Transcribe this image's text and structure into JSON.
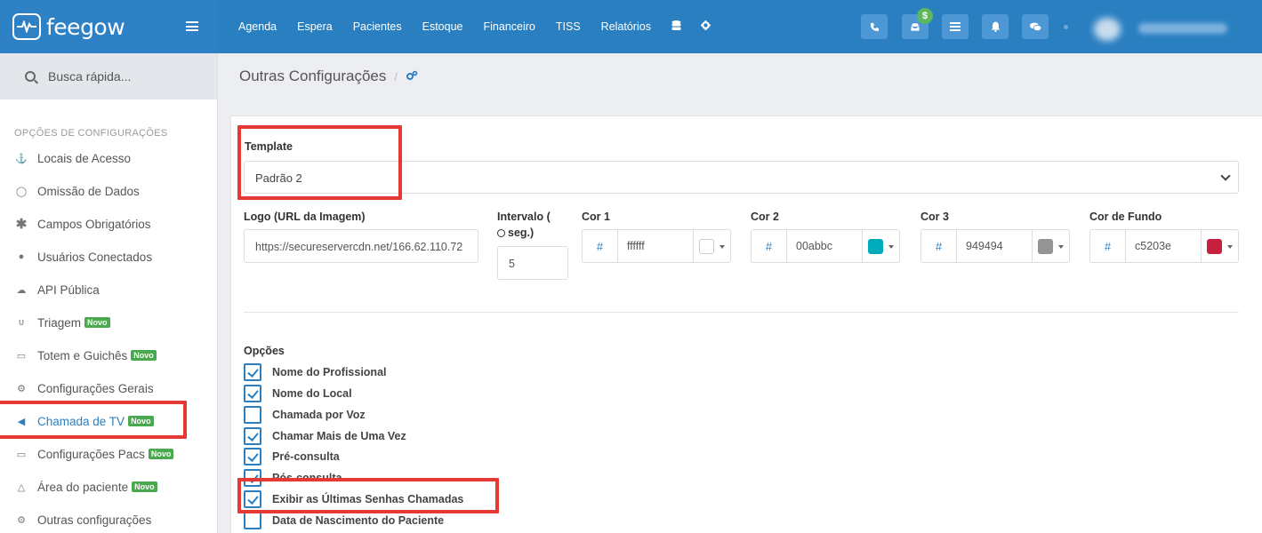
{
  "brand": {
    "name": "feegow"
  },
  "nav": [
    "Agenda",
    "Espera",
    "Pacientes",
    "Estoque",
    "Financeiro",
    "TISS",
    "Relatórios"
  ],
  "notification_badge": "$",
  "search": {
    "label": "Busca rápida..."
  },
  "sidebar": {
    "heading": "OPÇÕES DE CONFIGURAÇÕES",
    "items": [
      {
        "label": "Locais de Acesso",
        "icon": "map-pin-icon"
      },
      {
        "label": "Omissão de Dados",
        "icon": "eye-slash-icon"
      },
      {
        "label": "Campos Obrigatórios",
        "icon": "asterisk-icon"
      },
      {
        "label": "Usuários Conectados",
        "icon": "user-icon"
      },
      {
        "label": "API Pública",
        "icon": "cloud-icon"
      },
      {
        "label": "Triagem",
        "icon": "stethoscope-icon",
        "badge": "Novo"
      },
      {
        "label": "Totem e Guichês",
        "icon": "laptop-icon",
        "badge": "Novo"
      },
      {
        "label": "Configurações Gerais",
        "icon": "cogs-icon"
      },
      {
        "label": "Chamada de TV",
        "icon": "bullhorn-icon",
        "badge": "Novo",
        "active": true
      },
      {
        "label": "Configurações Pacs",
        "icon": "laptop-icon",
        "badge": "Novo"
      },
      {
        "label": "Área do paciente",
        "icon": "flask-icon",
        "badge": "Novo"
      },
      {
        "label": "Outras configurações",
        "icon": "cogs-icon"
      }
    ]
  },
  "page": {
    "title": "Outras Configurações",
    "breadcrumb_sep": "/"
  },
  "form": {
    "template_label": "Template",
    "template_value": "Padrão 2",
    "logo_label": "Logo (URL da Imagem)",
    "logo_value": "https://secureservercdn.net/166.62.110.72",
    "interval_label_1": "Intervalo (",
    "interval_label_2": "seg.)",
    "interval_value": "5",
    "colors": [
      {
        "label": "Cor 1",
        "hash": "#",
        "value": "ffffff",
        "swatch": "#ffffff"
      },
      {
        "label": "Cor 2",
        "hash": "#",
        "value": "00abbc",
        "swatch": "#00abbc"
      },
      {
        "label": "Cor 3",
        "hash": "#",
        "value": "949494",
        "swatch": "#949494"
      },
      {
        "label": "Cor de Fundo",
        "hash": "#",
        "value": "c5203e",
        "swatch": "#c5203e"
      }
    ],
    "options_label": "Opções",
    "options": [
      {
        "label": "Nome do Profissional",
        "checked": true
      },
      {
        "label": "Nome do Local",
        "checked": true
      },
      {
        "label": "Chamada por Voz",
        "checked": false
      },
      {
        "label": "Chamar Mais de Uma Vez",
        "checked": true
      },
      {
        "label": "Pré-consulta",
        "checked": true
      },
      {
        "label": "Pós-consulta",
        "checked": true
      },
      {
        "label": "Exibir as Últimas Senhas Chamadas",
        "checked": true
      },
      {
        "label": "Data de Nascimento do Paciente",
        "checked": false
      }
    ]
  },
  "accent_color": "#2a7fc1",
  "highlight_color": "#e53935"
}
